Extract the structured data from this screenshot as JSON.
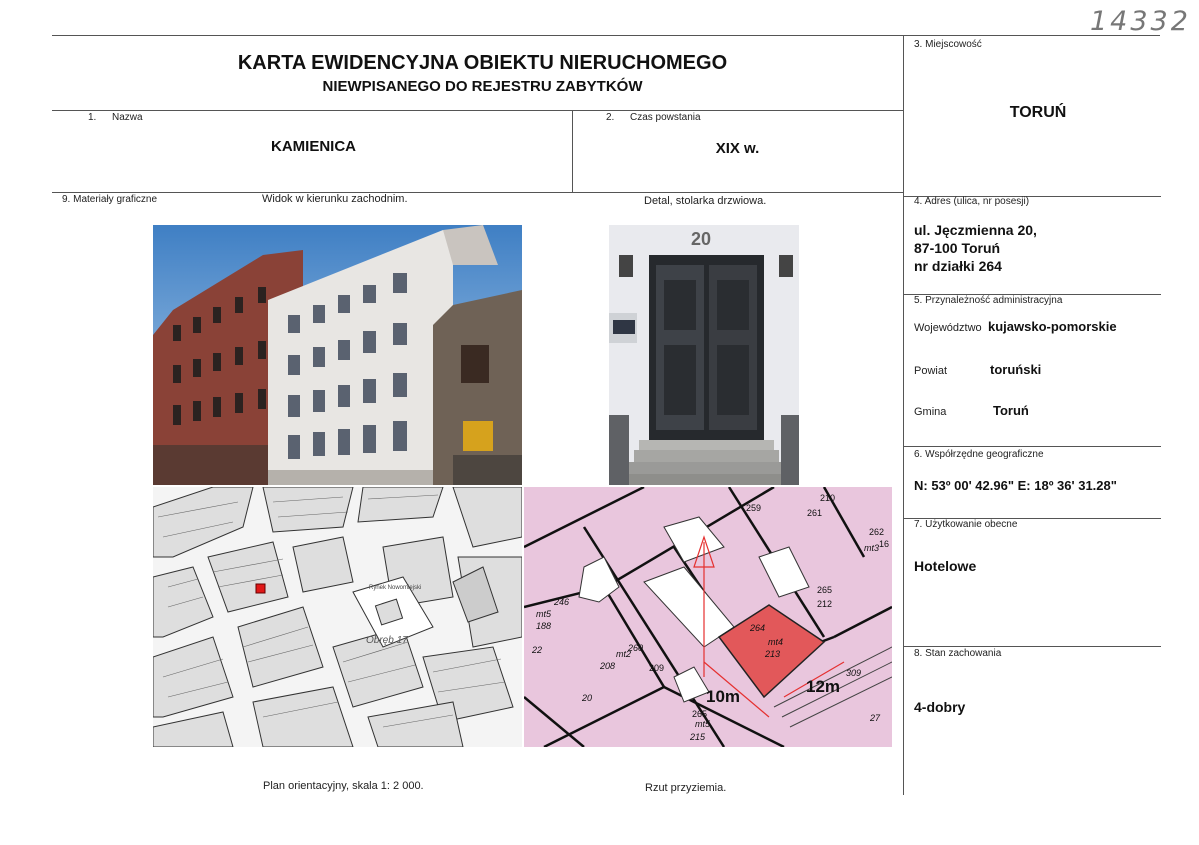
{
  "inventory_number": "14332",
  "title": {
    "line1": "KARTA EWIDENCYJNA OBIEKTU NIERUCHOMEGO",
    "line2": "NIEWPISANEGO DO REJESTRU ZABYTKÓW"
  },
  "fields": {
    "nazwa": {
      "num": "1.",
      "label": "Nazwa",
      "value": "KAMIENICA"
    },
    "czas": {
      "num": "2.",
      "label": "Czas powstania",
      "value": "XIX w."
    },
    "miejscowosc": {
      "label": "3. Miejscowość",
      "value": "TORUŃ"
    },
    "adres": {
      "label": "4. Adres (ulica, nr posesji)",
      "line1": "ul. Jęczmienna 20,",
      "line2": "87-100 Toruń",
      "line3": "nr działki 264"
    },
    "przynaleznosc": {
      "label": "5. Przynależność administracyjna",
      "woj_label": "Województwo",
      "woj_value": "kujawsko-pomorskie",
      "powiat_label": "Powiat",
      "powiat_value": "toruński",
      "gmina_label": "Gmina",
      "gmina_value": "Toruń"
    },
    "wspolrzedne": {
      "label": "6. Współrzędne geograficzne",
      "value": "N: 53º 00' 42.96\" E: 18º 36' 31.28\""
    },
    "uzytkowanie": {
      "label": "7. Użytkowanie obecne",
      "value": "Hotelowe"
    },
    "stan": {
      "label": "8. Stan zachowania",
      "value": "4-dobry"
    }
  },
  "graphics": {
    "label": "9. Materiały graficzne",
    "caption_view": "Widok w kierunku zachodnim.",
    "caption_detail": "Detal, stolarka drzwiowa.",
    "caption_plan": "Plan orientacyjny, skala 1: 2 000.",
    "caption_floor": "Rzut przyziemia.",
    "door_number": "20",
    "plan_label": "Obręb 17",
    "plan_square": "Rynek Nowomiejski",
    "map_labels": {
      "p259": "259",
      "p210": "210",
      "p261": "261",
      "p262": "262",
      "p16": "16",
      "mt3": "mt3",
      "p246": "246",
      "mt5a": "mt5",
      "p188": "188",
      "p265a": "265",
      "p212": "212",
      "p264": "264",
      "mt4": "mt4",
      "p213": "213",
      "p22a": "22",
      "mt2": "mt2",
      "p208": "208",
      "p260": "260",
      "p209": "209",
      "p309": "309",
      "p265b": "265",
      "mt5b": "mt5",
      "p215": "215",
      "p20": "20",
      "p27": "27",
      "dim10": "10m",
      "dim12": "12m"
    }
  }
}
